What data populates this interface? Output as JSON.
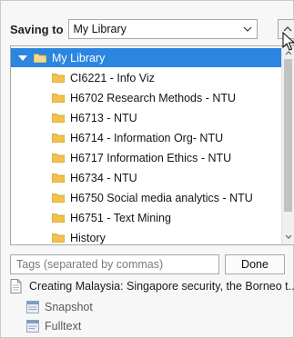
{
  "saving": {
    "label": "Saving to",
    "selected": "My Library"
  },
  "tree": {
    "root": {
      "label": "My Library",
      "expanded": true,
      "selected": true
    },
    "items": [
      {
        "label": "CI6221 - Info Viz"
      },
      {
        "label": "H6702 Research Methods - NTU"
      },
      {
        "label": "H6713 - NTU"
      },
      {
        "label": "H6714 - Information Org- NTU"
      },
      {
        "label": "H6717 Information Ethics - NTU"
      },
      {
        "label": "H6734 - NTU"
      },
      {
        "label": "H6750 Social media analytics - NTU"
      },
      {
        "label": "H6751 - Text Mining"
      },
      {
        "label": "History"
      }
    ]
  },
  "tags": {
    "placeholder": "Tags (separated by commas)",
    "done_label": "Done"
  },
  "item": {
    "title": "Creating Malaysia: Singapore security, the Borneo t...",
    "attachments": [
      {
        "label": "Snapshot",
        "icon": "snapshot-icon"
      },
      {
        "label": "Fulltext",
        "icon": "pdf-icon"
      }
    ]
  },
  "colors": {
    "selection": "#2a86e0",
    "folder": "#f2c14e"
  }
}
